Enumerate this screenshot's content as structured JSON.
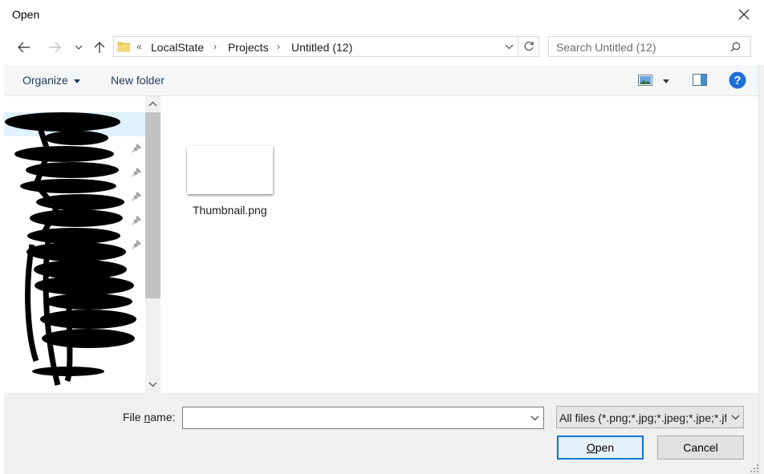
{
  "window": {
    "title": "Open"
  },
  "nav": {
    "breadcrumbs": [
      "LocalState",
      "Projects",
      "Untitled (12)"
    ],
    "overflow": "«",
    "search_placeholder": "Search Untitled (12)"
  },
  "toolbar": {
    "organize": "Organize",
    "new_folder": "New folder"
  },
  "files": [
    {
      "name": "Thumbnail.png"
    }
  ],
  "footer": {
    "file_name_label_pre": "File ",
    "file_name_label_u": "n",
    "file_name_label_post": "ame:",
    "file_name_value": "",
    "filter": "All files (*.png;*.jpg;*.jpeg;*.jpe;*.jfif)",
    "open_u": "O",
    "open_rest": "pen",
    "cancel": "Cancel"
  },
  "icons": {
    "back": "arrow-left-icon",
    "forward": "arrow-right-icon",
    "recent": "chevron-down-icon",
    "up": "arrow-up-icon",
    "folder": "folder-icon",
    "refresh": "refresh-icon",
    "search": "search-icon",
    "view": "view-icon",
    "preview": "preview-pane-icon",
    "help": "help-icon",
    "pin": "pin-icon",
    "close": "close-icon"
  },
  "colors": {
    "accent": "#0078d7",
    "help": "#1e6fd9",
    "command_text": "#1e395b"
  }
}
